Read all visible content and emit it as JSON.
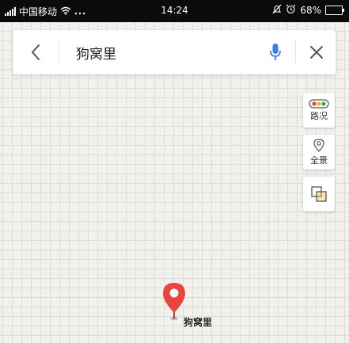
{
  "status_bar": {
    "carrier": "中国移动",
    "time": "14:24",
    "battery": "68%",
    "battery_level": 0.68,
    "icons": [
      "signal-icon",
      "wifi-icon",
      "more-dots-icon",
      "mute-icon",
      "alarm-icon",
      "battery-icon"
    ]
  },
  "search": {
    "query": "狗窝里",
    "icons": [
      "back-arrow-icon",
      "microphone-icon",
      "close-icon"
    ]
  },
  "map_tools": {
    "traffic_label": "路况",
    "panorama_label": "全景",
    "layers_icon": "layers-icon"
  },
  "marker": {
    "label": "狗窝里",
    "color": "#e8453c"
  },
  "colors": {
    "accent": "#3b7bea",
    "map_background": "#f2f1ee",
    "grid_line": "#dcdbd6"
  }
}
